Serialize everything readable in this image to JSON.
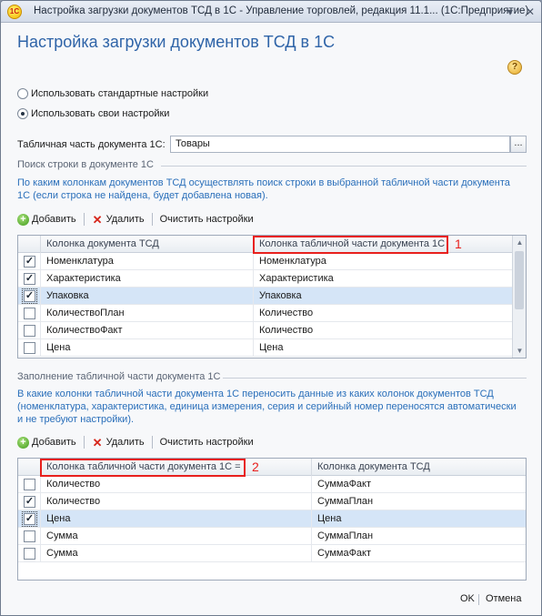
{
  "window": {
    "app_icon_text": "1С",
    "title": "Настройка загрузки документов ТСД в 1С - Управление торговлей, редакция 11.1...   (1С:Предприятие)",
    "help_icon": "?"
  },
  "form": {
    "title": "Настройка загрузки документов ТСД в 1С",
    "radio_standard": "Использовать стандартные настройки",
    "radio_custom": "Использовать свои настройки",
    "selected_radio": "custom",
    "table_part_label": "Табличная часть документа 1С:",
    "table_part_value": "Товары",
    "select_button": "..."
  },
  "search_section": {
    "title": "Поиск строки в документе 1С",
    "hint": "По каким колонкам документов ТСД осуществлять поиск строки в выбранной табличной части документа 1С (если строка не найдена, будет добавлена новая).",
    "toolbar": {
      "add": "Добавить",
      "delete": "Удалить",
      "clear": "Очистить настройки"
    },
    "columns": [
      "Колонка документа ТСД",
      "Колонка табличной части документа 1С"
    ],
    "annotation": "1",
    "rows": [
      {
        "checked": true,
        "tsd": "Номенклатура",
        "doc": "Номенклатура"
      },
      {
        "checked": true,
        "tsd": "Характеристика",
        "doc": "Характеристика"
      },
      {
        "checked": true,
        "tsd": "Упаковка",
        "doc": "Упаковка",
        "selected": true
      },
      {
        "checked": false,
        "tsd": "КоличествоПлан",
        "doc": "Количество"
      },
      {
        "checked": false,
        "tsd": "КоличествоФакт",
        "doc": "Количество"
      },
      {
        "checked": false,
        "tsd": "Цена",
        "doc": "Цена"
      }
    ]
  },
  "fill_section": {
    "title": "Заполнение табличной части документа 1С",
    "hint": "В какие колонки табличной части документа 1С переносить данные из каких колонок документов ТСД (номенклатура, характеристика, единица измерения, серия и серийный номер переносятся автоматически и не требуют настройки).",
    "toolbar": {
      "add": "Добавить",
      "delete": "Удалить",
      "clear": "Очистить настройки"
    },
    "columns": [
      "Колонка табличной части документа 1С =",
      "Колонка документа ТСД"
    ],
    "annotation": "2",
    "rows": [
      {
        "checked": false,
        "doc": "Количество",
        "tsd": "СуммаФакт"
      },
      {
        "checked": true,
        "doc": "Количество",
        "tsd": "СуммаПлан"
      },
      {
        "checked": true,
        "doc": "Цена",
        "tsd": "Цена",
        "selected": true
      },
      {
        "checked": false,
        "doc": "Сумма",
        "tsd": "СуммаПлан"
      },
      {
        "checked": false,
        "doc": "Сумма",
        "tsd": "СуммаФакт"
      }
    ]
  },
  "footer": {
    "ok": "OK",
    "cancel": "Отмена"
  },
  "colors": {
    "title_blue": "#2f64a8",
    "hint_blue": "#2a6fba",
    "annotation_red": "#e8201d",
    "selection": "#d5e5f7"
  }
}
